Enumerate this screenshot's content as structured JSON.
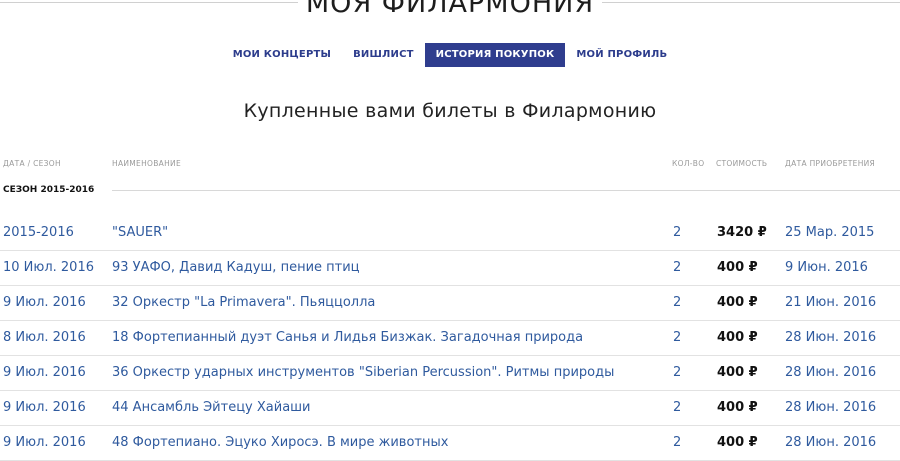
{
  "header": {
    "title": "МОЯ ФИЛАРМОНИЯ"
  },
  "tabs": [
    {
      "label": "МОИ КОНЦЕРТЫ",
      "active": false
    },
    {
      "label": "ВИШЛИСТ",
      "active": false
    },
    {
      "label": "ИСТОРИЯ ПОКУПОК",
      "active": true
    },
    {
      "label": "МОЙ ПРОФИЛЬ",
      "active": false
    }
  ],
  "subtitle": "Купленные вами билеты в Филармонию",
  "columns": {
    "date": "ДАТА / СЕЗОН",
    "name": "НАИМЕНОВАНИЕ",
    "qty": "КОЛ-ВО",
    "price": "СТОИМОСТЬ",
    "purchase_date": "ДАТА ПРИОБРЕТЕНИЯ"
  },
  "season": {
    "label": "СЕЗОН 2015-2016"
  },
  "rows": [
    {
      "date": "2015-2016",
      "name": "\"SAUER\"",
      "qty": "2",
      "price": "3420 ₽",
      "purchase_date": "25 Мар. 2015"
    },
    {
      "date": "10 Июл. 2016",
      "name": "93 УАФО, Давид Кадуш, пение птиц",
      "qty": "2",
      "price": "400 ₽",
      "purchase_date": "9 Июн. 2016"
    },
    {
      "date": "9 Июл. 2016",
      "name": "32 Оркестр \"La Primavera\". Пьяццолла",
      "qty": "2",
      "price": "400 ₽",
      "purchase_date": "21 Июн. 2016"
    },
    {
      "date": "8 Июл. 2016",
      "name": "18 Фортепианный дуэт Санья и Лидья Бизжак. Загадочная природа",
      "qty": "2",
      "price": "400 ₽",
      "purchase_date": "28 Июн. 2016"
    },
    {
      "date": "9 Июл. 2016",
      "name": "36 Оркестр ударных инструментов \"Siberian Percussion\". Ритмы природы",
      "qty": "2",
      "price": "400 ₽",
      "purchase_date": "28 Июн. 2016"
    },
    {
      "date": "9 Июл. 2016",
      "name": "44 Ансамбль Эйтецу Хайаши",
      "qty": "2",
      "price": "400 ₽",
      "purchase_date": "28 Июн. 2016"
    },
    {
      "date": "9 Июл. 2016",
      "name": "48 Фортепиано. Эцуко Хиросэ. В мире животных",
      "qty": "2",
      "price": "400 ₽",
      "purchase_date": "28 Июн. 2016"
    }
  ],
  "colors": {
    "accent": "#2f3d8e",
    "link": "#2f5a9e"
  }
}
